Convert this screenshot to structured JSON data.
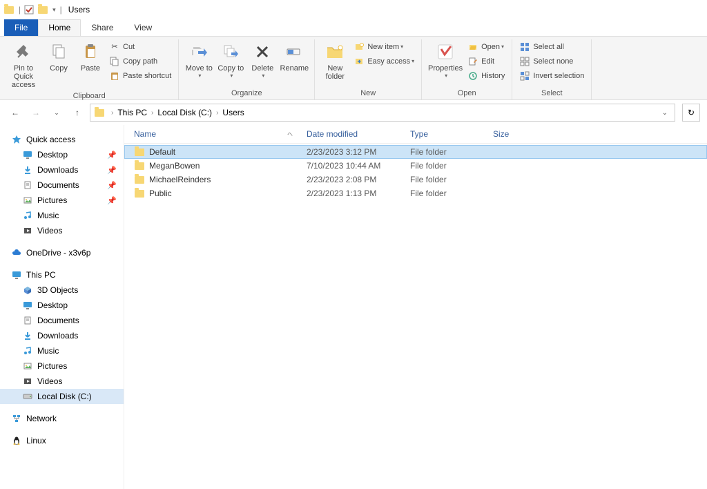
{
  "window": {
    "title": "Users"
  },
  "tabs": {
    "file": "File",
    "home": "Home",
    "share": "Share",
    "view": "View"
  },
  "ribbon": {
    "clipboard": {
      "label": "Clipboard",
      "pin": "Pin to Quick access",
      "copy": "Copy",
      "paste": "Paste",
      "cut": "Cut",
      "copypath": "Copy path",
      "pasteshortcut": "Paste shortcut"
    },
    "organize": {
      "label": "Organize",
      "moveto": "Move to",
      "copyto": "Copy to",
      "delete": "Delete",
      "rename": "Rename"
    },
    "new": {
      "label": "New",
      "newfolder": "New folder",
      "newitem": "New item",
      "easyaccess": "Easy access"
    },
    "open": {
      "label": "Open",
      "properties": "Properties",
      "open": "Open",
      "edit": "Edit",
      "history": "History"
    },
    "select": {
      "label": "Select",
      "all": "Select all",
      "none": "Select none",
      "invert": "Invert selection"
    }
  },
  "breadcrumb": [
    "This PC",
    "Local Disk (C:)",
    "Users"
  ],
  "sidebar": {
    "quickaccess": "Quick access",
    "qa": [
      {
        "label": "Desktop",
        "pin": true
      },
      {
        "label": "Downloads",
        "pin": true
      },
      {
        "label": "Documents",
        "pin": true
      },
      {
        "label": "Pictures",
        "pin": true
      },
      {
        "label": "Music",
        "pin": false
      },
      {
        "label": "Videos",
        "pin": false
      }
    ],
    "onedrive": "OneDrive - x3v6p",
    "thispc": "This PC",
    "pc": [
      "3D Objects",
      "Desktop",
      "Documents",
      "Downloads",
      "Music",
      "Pictures",
      "Videos",
      "Local Disk (C:)"
    ],
    "network": "Network",
    "linux": "Linux"
  },
  "columns": {
    "name": "Name",
    "date": "Date modified",
    "type": "Type",
    "size": "Size"
  },
  "files": [
    {
      "name": "Default",
      "date": "2/23/2023 3:12 PM",
      "type": "File folder",
      "selected": true
    },
    {
      "name": "MeganBowen",
      "date": "7/10/2023 10:44 AM",
      "type": "File folder",
      "selected": false
    },
    {
      "name": "MichaelReinders",
      "date": "2/23/2023 2:08 PM",
      "type": "File folder",
      "selected": false
    },
    {
      "name": "Public",
      "date": "2/23/2023 1:13 PM",
      "type": "File folder",
      "selected": false
    }
  ]
}
